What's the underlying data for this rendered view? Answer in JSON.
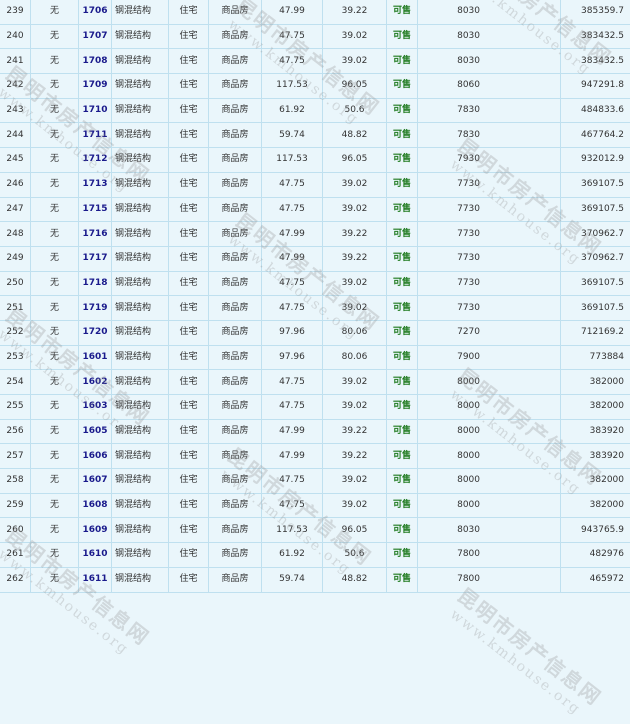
{
  "status_color": "#1e7a1e",
  "room_color": "#1a1a8c",
  "watermark": {
    "cn": "昆明市房产信息网",
    "en": "www.kmhouse.org"
  },
  "rows": [
    {
      "idx": "239",
      "none": "无",
      "room": "1706",
      "structure": "钢混结构",
      "use": "住宅",
      "type": "商品房",
      "area": "47.99",
      "inner": "39.22",
      "status": "可售",
      "price": "8030",
      "total": "385359.7"
    },
    {
      "idx": "240",
      "none": "无",
      "room": "1707",
      "structure": "钢混结构",
      "use": "住宅",
      "type": "商品房",
      "area": "47.75",
      "inner": "39.02",
      "status": "可售",
      "price": "8030",
      "total": "383432.5"
    },
    {
      "idx": "241",
      "none": "无",
      "room": "1708",
      "structure": "钢混结构",
      "use": "住宅",
      "type": "商品房",
      "area": "47.75",
      "inner": "39.02",
      "status": "可售",
      "price": "8030",
      "total": "383432.5"
    },
    {
      "idx": "242",
      "none": "无",
      "room": "1709",
      "structure": "钢混结构",
      "use": "住宅",
      "type": "商品房",
      "area": "117.53",
      "inner": "96.05",
      "status": "可售",
      "price": "8060",
      "total": "947291.8"
    },
    {
      "idx": "243",
      "none": "无",
      "room": "1710",
      "structure": "钢混结构",
      "use": "住宅",
      "type": "商品房",
      "area": "61.92",
      "inner": "50.6",
      "status": "可售",
      "price": "7830",
      "total": "484833.6"
    },
    {
      "idx": "244",
      "none": "无",
      "room": "1711",
      "structure": "钢混结构",
      "use": "住宅",
      "type": "商品房",
      "area": "59.74",
      "inner": "48.82",
      "status": "可售",
      "price": "7830",
      "total": "467764.2"
    },
    {
      "idx": "245",
      "none": "无",
      "room": "1712",
      "structure": "钢混结构",
      "use": "住宅",
      "type": "商品房",
      "area": "117.53",
      "inner": "96.05",
      "status": "可售",
      "price": "7930",
      "total": "932012.9"
    },
    {
      "idx": "246",
      "none": "无",
      "room": "1713",
      "structure": "钢混结构",
      "use": "住宅",
      "type": "商品房",
      "area": "47.75",
      "inner": "39.02",
      "status": "可售",
      "price": "7730",
      "total": "369107.5"
    },
    {
      "idx": "247",
      "none": "无",
      "room": "1715",
      "structure": "钢混结构",
      "use": "住宅",
      "type": "商品房",
      "area": "47.75",
      "inner": "39.02",
      "status": "可售",
      "price": "7730",
      "total": "369107.5"
    },
    {
      "idx": "248",
      "none": "无",
      "room": "1716",
      "structure": "钢混结构",
      "use": "住宅",
      "type": "商品房",
      "area": "47.99",
      "inner": "39.22",
      "status": "可售",
      "price": "7730",
      "total": "370962.7"
    },
    {
      "idx": "249",
      "none": "无",
      "room": "1717",
      "structure": "钢混结构",
      "use": "住宅",
      "type": "商品房",
      "area": "47.99",
      "inner": "39.22",
      "status": "可售",
      "price": "7730",
      "total": "370962.7"
    },
    {
      "idx": "250",
      "none": "无",
      "room": "1718",
      "structure": "钢混结构",
      "use": "住宅",
      "type": "商品房",
      "area": "47.75",
      "inner": "39.02",
      "status": "可售",
      "price": "7730",
      "total": "369107.5"
    },
    {
      "idx": "251",
      "none": "无",
      "room": "1719",
      "structure": "钢混结构",
      "use": "住宅",
      "type": "商品房",
      "area": "47.75",
      "inner": "39.02",
      "status": "可售",
      "price": "7730",
      "total": "369107.5"
    },
    {
      "idx": "252",
      "none": "无",
      "room": "1720",
      "structure": "钢混结构",
      "use": "住宅",
      "type": "商品房",
      "area": "97.96",
      "inner": "80.06",
      "status": "可售",
      "price": "7270",
      "total": "712169.2"
    },
    {
      "idx": "253",
      "none": "无",
      "room": "1601",
      "structure": "钢混结构",
      "use": "住宅",
      "type": "商品房",
      "area": "97.96",
      "inner": "80.06",
      "status": "可售",
      "price": "7900",
      "total": "773884"
    },
    {
      "idx": "254",
      "none": "无",
      "room": "1602",
      "structure": "钢混结构",
      "use": "住宅",
      "type": "商品房",
      "area": "47.75",
      "inner": "39.02",
      "status": "可售",
      "price": "8000",
      "total": "382000"
    },
    {
      "idx": "255",
      "none": "无",
      "room": "1603",
      "structure": "钢混结构",
      "use": "住宅",
      "type": "商品房",
      "area": "47.75",
      "inner": "39.02",
      "status": "可售",
      "price": "8000",
      "total": "382000"
    },
    {
      "idx": "256",
      "none": "无",
      "room": "1605",
      "structure": "钢混结构",
      "use": "住宅",
      "type": "商品房",
      "area": "47.99",
      "inner": "39.22",
      "status": "可售",
      "price": "8000",
      "total": "383920"
    },
    {
      "idx": "257",
      "none": "无",
      "room": "1606",
      "structure": "钢混结构",
      "use": "住宅",
      "type": "商品房",
      "area": "47.99",
      "inner": "39.22",
      "status": "可售",
      "price": "8000",
      "total": "383920"
    },
    {
      "idx": "258",
      "none": "无",
      "room": "1607",
      "structure": "钢混结构",
      "use": "住宅",
      "type": "商品房",
      "area": "47.75",
      "inner": "39.02",
      "status": "可售",
      "price": "8000",
      "total": "382000"
    },
    {
      "idx": "259",
      "none": "无",
      "room": "1608",
      "structure": "钢混结构",
      "use": "住宅",
      "type": "商品房",
      "area": "47.75",
      "inner": "39.02",
      "status": "可售",
      "price": "8000",
      "total": "382000"
    },
    {
      "idx": "260",
      "none": "无",
      "room": "1609",
      "structure": "钢混结构",
      "use": "住宅",
      "type": "商品房",
      "area": "117.53",
      "inner": "96.05",
      "status": "可售",
      "price": "8030",
      "total": "943765.9"
    },
    {
      "idx": "261",
      "none": "无",
      "room": "1610",
      "structure": "钢混结构",
      "use": "住宅",
      "type": "商品房",
      "area": "61.92",
      "inner": "50.6",
      "status": "可售",
      "price": "7800",
      "total": "482976"
    },
    {
      "idx": "262",
      "none": "无",
      "room": "1611",
      "structure": "钢混结构",
      "use": "住宅",
      "type": "商品房",
      "area": "59.74",
      "inner": "48.82",
      "status": "可售",
      "price": "7800",
      "total": "465972"
    }
  ]
}
